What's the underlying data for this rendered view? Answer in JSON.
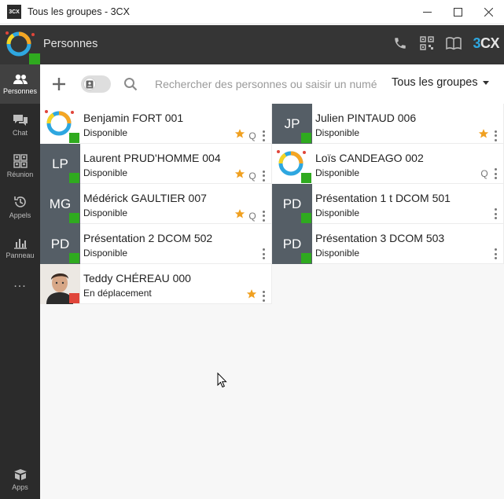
{
  "window": {
    "title": "Tous les groupes - 3CX",
    "logo_text": "3CX"
  },
  "header": {
    "title": "Personnes",
    "logo_text_3": "3",
    "logo_text_cx": "CX"
  },
  "sidebar": {
    "items": [
      {
        "label": "Personnes",
        "icon": "people-icon",
        "active": true
      },
      {
        "label": "Chat",
        "icon": "chat-icon",
        "active": false
      },
      {
        "label": "Réunion",
        "icon": "meeting-icon",
        "active": false
      },
      {
        "label": "Appels",
        "icon": "history-icon",
        "active": false
      },
      {
        "label": "Panneau",
        "icon": "panel-icon",
        "active": false
      }
    ],
    "more": "...",
    "apps_label": "Apps"
  },
  "toolbar": {
    "search_placeholder": "Rechercher des personnes ou saisir un numéro",
    "group_filter": "Tous les groupes"
  },
  "contacts": [
    {
      "name": "Benjamin FORT 001",
      "status": "Disponible",
      "avatar": "logo",
      "initials": "",
      "presence": "available",
      "favorite": true,
      "q": true
    },
    {
      "name": "Julien PINTAUD 006",
      "status": "Disponible",
      "avatar": "initials",
      "initials": "JP",
      "presence": "available",
      "favorite": true,
      "q": false
    },
    {
      "name": "Laurent PRUD'HOMME 004",
      "status": "Disponible",
      "avatar": "initials",
      "initials": "LP",
      "presence": "available",
      "favorite": true,
      "q": true
    },
    {
      "name": "Loïs CANDEAGO 002",
      "status": "Disponible",
      "avatar": "logo",
      "initials": "",
      "presence": "available",
      "favorite": false,
      "q": true
    },
    {
      "name": "Médérick GAULTIER 007",
      "status": "Disponible",
      "avatar": "initials",
      "initials": "MG",
      "presence": "available",
      "favorite": true,
      "q": true
    },
    {
      "name": "Présentation 1 t DCOM 501",
      "status": "Disponible",
      "avatar": "initials",
      "initials": "PD",
      "presence": "available",
      "favorite": false,
      "q": false
    },
    {
      "name": "Présentation 2 DCOM 502",
      "status": "Disponible",
      "avatar": "initials",
      "initials": "PD",
      "presence": "available",
      "favorite": false,
      "q": false
    },
    {
      "name": "Présentation 3 DCOM 503",
      "status": "Disponible",
      "avatar": "initials",
      "initials": "PD",
      "presence": "available",
      "favorite": false,
      "q": false
    },
    {
      "name": "Teddy CHÉREAU 000",
      "status": "En déplacement",
      "avatar": "photo",
      "initials": "",
      "presence": "away",
      "favorite": true,
      "q": false
    }
  ],
  "colors": {
    "available": "#2faa1f",
    "away": "#e0453a",
    "star": "#f0a020",
    "accent": "#2ea7e0"
  }
}
